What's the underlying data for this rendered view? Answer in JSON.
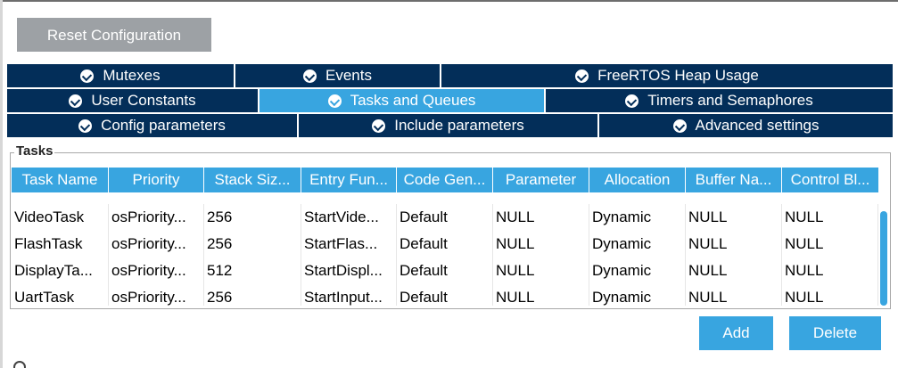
{
  "toolbar": {
    "reset_label": "Reset Configuration"
  },
  "tabs": {
    "row1": [
      "Mutexes",
      "Events",
      "FreeRTOS Heap Usage"
    ],
    "row2": [
      "User Constants",
      "Tasks and Queues",
      "Timers and Semaphores"
    ],
    "row3": [
      "Config parameters",
      "Include parameters",
      "Advanced settings"
    ],
    "active": "Tasks and Queues"
  },
  "tasks": {
    "title": "Tasks",
    "columns": [
      "Task Name",
      "Priority",
      "Stack Siz...",
      "Entry Fun...",
      "Code Gen...",
      "Parameter",
      "Allocation",
      "Buffer Na...",
      "Control Bl..."
    ],
    "rows": [
      [
        "VideoTask",
        "osPriority...",
        "256",
        "StartVide...",
        "Default",
        "NULL",
        "Dynamic",
        "NULL",
        "NULL"
      ],
      [
        "FlashTask",
        "osPriority...",
        "256",
        "StartFlas...",
        "Default",
        "NULL",
        "Dynamic",
        "NULL",
        "NULL"
      ],
      [
        "DisplayTa...",
        "osPriority...",
        "512",
        "StartDispl...",
        "Default",
        "NULL",
        "Dynamic",
        "NULL",
        "NULL"
      ],
      [
        "UartTask",
        "osPriority...",
        "256",
        "StartInput...",
        "Default",
        "NULL",
        "Dynamic",
        "NULL",
        "NULL"
      ]
    ]
  },
  "actions": {
    "add_label": "Add",
    "delete_label": "Delete"
  },
  "colors": {
    "tab_dark": "#032e59",
    "accent": "#38a5e0",
    "reset_button": "#9da1a5"
  },
  "icons": {
    "tab_status": "check-circle-icon"
  }
}
